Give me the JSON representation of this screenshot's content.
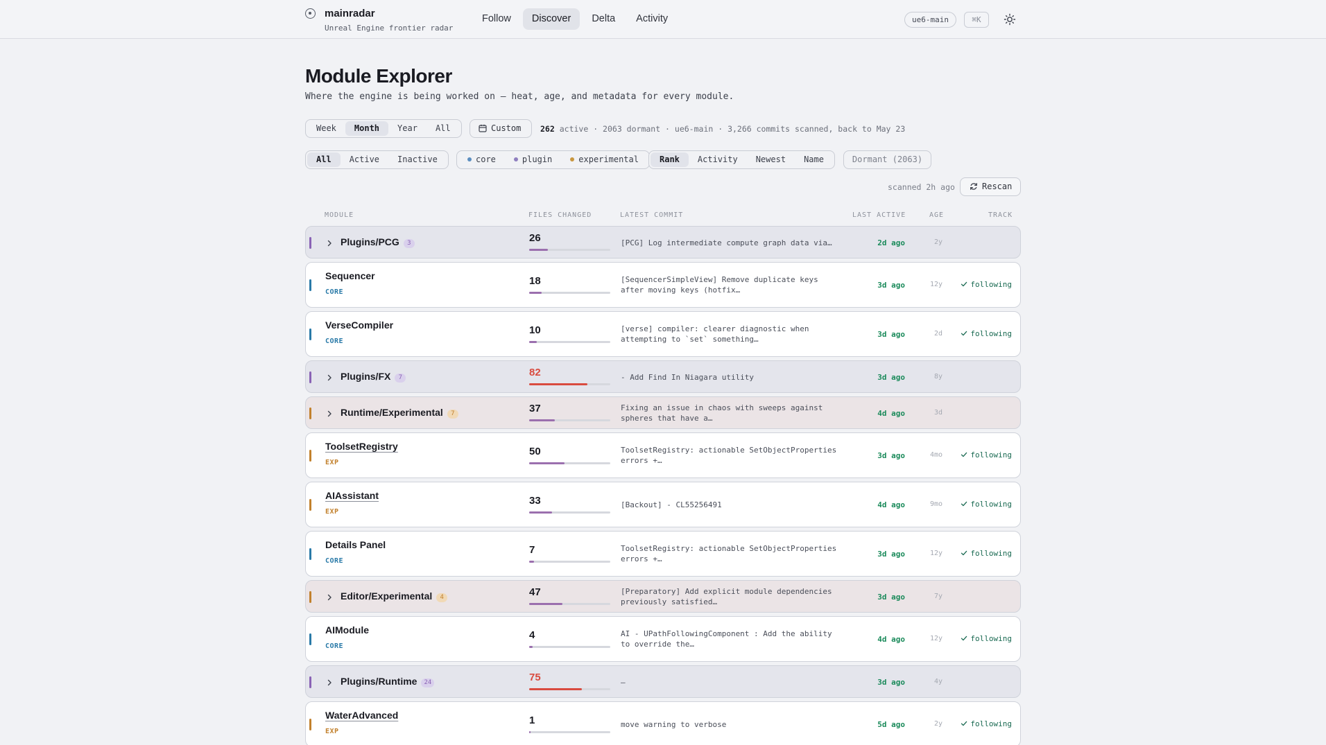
{
  "app": {
    "name": "mainradar",
    "subtitle": "Unreal Engine frontier radar",
    "branch": "ue6-main",
    "shortcut": "⌘K"
  },
  "nav": [
    {
      "label": "Follow",
      "active": false
    },
    {
      "label": "Discover",
      "active": true
    },
    {
      "label": "Delta",
      "active": false
    },
    {
      "label": "Activity",
      "active": false
    }
  ],
  "page": {
    "title": "Module Explorer",
    "subtitle": "Where the engine is being worked on — heat, age, and metadata for every module."
  },
  "range": {
    "options": [
      "Week",
      "Month",
      "Year",
      "All"
    ],
    "selected": "Month",
    "custom_label": "Custom"
  },
  "stats": {
    "active": "262",
    "active_label": "active",
    "rest": "· 2063 dormant · ue6-main · 3,266 commits scanned, back to May 23"
  },
  "filters": {
    "status": [
      "All",
      "Active",
      "Inactive"
    ],
    "status_selected": "All",
    "kinds": [
      {
        "label": "core",
        "color": "#5b8ec0"
      },
      {
        "label": "plugin",
        "color": "#8f7fbf"
      },
      {
        "label": "experimental",
        "color": "#c9973f"
      }
    ],
    "sort": [
      "Rank",
      "Activity",
      "Newest",
      "Name"
    ],
    "sort_selected": "Rank",
    "dormant_label": "Dormant (2063)"
  },
  "scan": {
    "scanned": "scanned 2h ago",
    "rescan_label": "Rescan"
  },
  "columns": {
    "module": "MODULE",
    "files": "FILES CHANGED",
    "commit": "LATEST COMMIT",
    "last": "LAST ACTIVE",
    "age": "AGE",
    "track": "TRACK"
  },
  "colors": {
    "core": "#2a7aa8",
    "plugin": "#8a63b5",
    "experimental": "#c2812d",
    "heat_normal": "#9b6fae",
    "heat_hot": "#d94b3f",
    "active_green": "#1a8a5a"
  },
  "rows": [
    {
      "type": "group",
      "kind": "plugin",
      "name": "Plugins/PCG",
      "count": "3",
      "files": "26",
      "fill": 0.23,
      "hot": false,
      "commit": "[PCG] Log intermediate compute graph data via…",
      "last": "2d ago",
      "age": "2y",
      "track": ""
    },
    {
      "type": "module",
      "kind": "core",
      "name": "Sequencer",
      "tag": "CORE",
      "underline": false,
      "files": "18",
      "fill": 0.15,
      "hot": false,
      "commit": "[SequencerSimpleView] Remove duplicate keys after moving keys (hotfix…",
      "last": "3d ago",
      "age": "12y",
      "track": "following"
    },
    {
      "type": "module",
      "kind": "core",
      "name": "VerseCompiler",
      "tag": "CORE",
      "underline": false,
      "files": "10",
      "fill": 0.09,
      "hot": false,
      "commit": "[verse] compiler: clearer diagnostic when attempting to `set` something…",
      "last": "3d ago",
      "age": "2d",
      "track": "following"
    },
    {
      "type": "group",
      "kind": "plugin",
      "name": "Plugins/FX",
      "count": "7",
      "files": "82",
      "fill": 0.72,
      "hot": true,
      "commit": "- Add Find In Niagara utility",
      "last": "3d ago",
      "age": "8y",
      "track": ""
    },
    {
      "type": "group",
      "kind": "experimental",
      "name": "Runtime/Experimental",
      "count": "7",
      "files": "37",
      "fill": 0.32,
      "hot": false,
      "commit": "Fixing an issue in chaos with sweeps against spheres that have a…",
      "last": "4d ago",
      "age": "3d",
      "track": ""
    },
    {
      "type": "module",
      "kind": "experimental",
      "name": "ToolsetRegistry",
      "tag": "EXP",
      "underline": true,
      "files": "50",
      "fill": 0.44,
      "hot": false,
      "commit": "ToolsetRegistry: actionable SetObjectProperties errors +…",
      "last": "3d ago",
      "age": "4mo",
      "track": "following"
    },
    {
      "type": "module",
      "kind": "experimental",
      "name": "AIAssistant",
      "tag": "EXP",
      "underline": true,
      "files": "33",
      "fill": 0.28,
      "hot": false,
      "commit": "[Backout] - CL55256491",
      "last": "4d ago",
      "age": "9mo",
      "track": "following"
    },
    {
      "type": "module",
      "kind": "core",
      "name": "Details Panel",
      "tag": "CORE",
      "underline": false,
      "files": "7",
      "fill": 0.06,
      "hot": false,
      "commit": "ToolsetRegistry: actionable SetObjectProperties errors +…",
      "last": "3d ago",
      "age": "12y",
      "track": "following"
    },
    {
      "type": "group",
      "kind": "experimental",
      "name": "Editor/Experimental",
      "count": "4",
      "files": "47",
      "fill": 0.41,
      "hot": false,
      "commit": "[Preparatory] Add explicit module dependencies previously satisfied…",
      "last": "3d ago",
      "age": "7y",
      "track": ""
    },
    {
      "type": "module",
      "kind": "core",
      "name": "AIModule",
      "tag": "CORE",
      "underline": false,
      "files": "4",
      "fill": 0.04,
      "hot": false,
      "commit": "AI - UPathFollowingComponent : Add the ability to override the…",
      "last": "4d ago",
      "age": "12y",
      "track": "following"
    },
    {
      "type": "group",
      "kind": "plugin",
      "name": "Plugins/Runtime",
      "count": "24",
      "files": "75",
      "fill": 0.65,
      "hot": true,
      "commit": "—",
      "last": "3d ago",
      "age": "4y",
      "track": ""
    },
    {
      "type": "module",
      "kind": "experimental",
      "name": "WaterAdvanced",
      "tag": "EXP",
      "underline": true,
      "files": "1",
      "fill": 0.02,
      "hot": false,
      "commit": "move warning to verbose",
      "last": "5d ago",
      "age": "2y",
      "track": "following"
    }
  ]
}
